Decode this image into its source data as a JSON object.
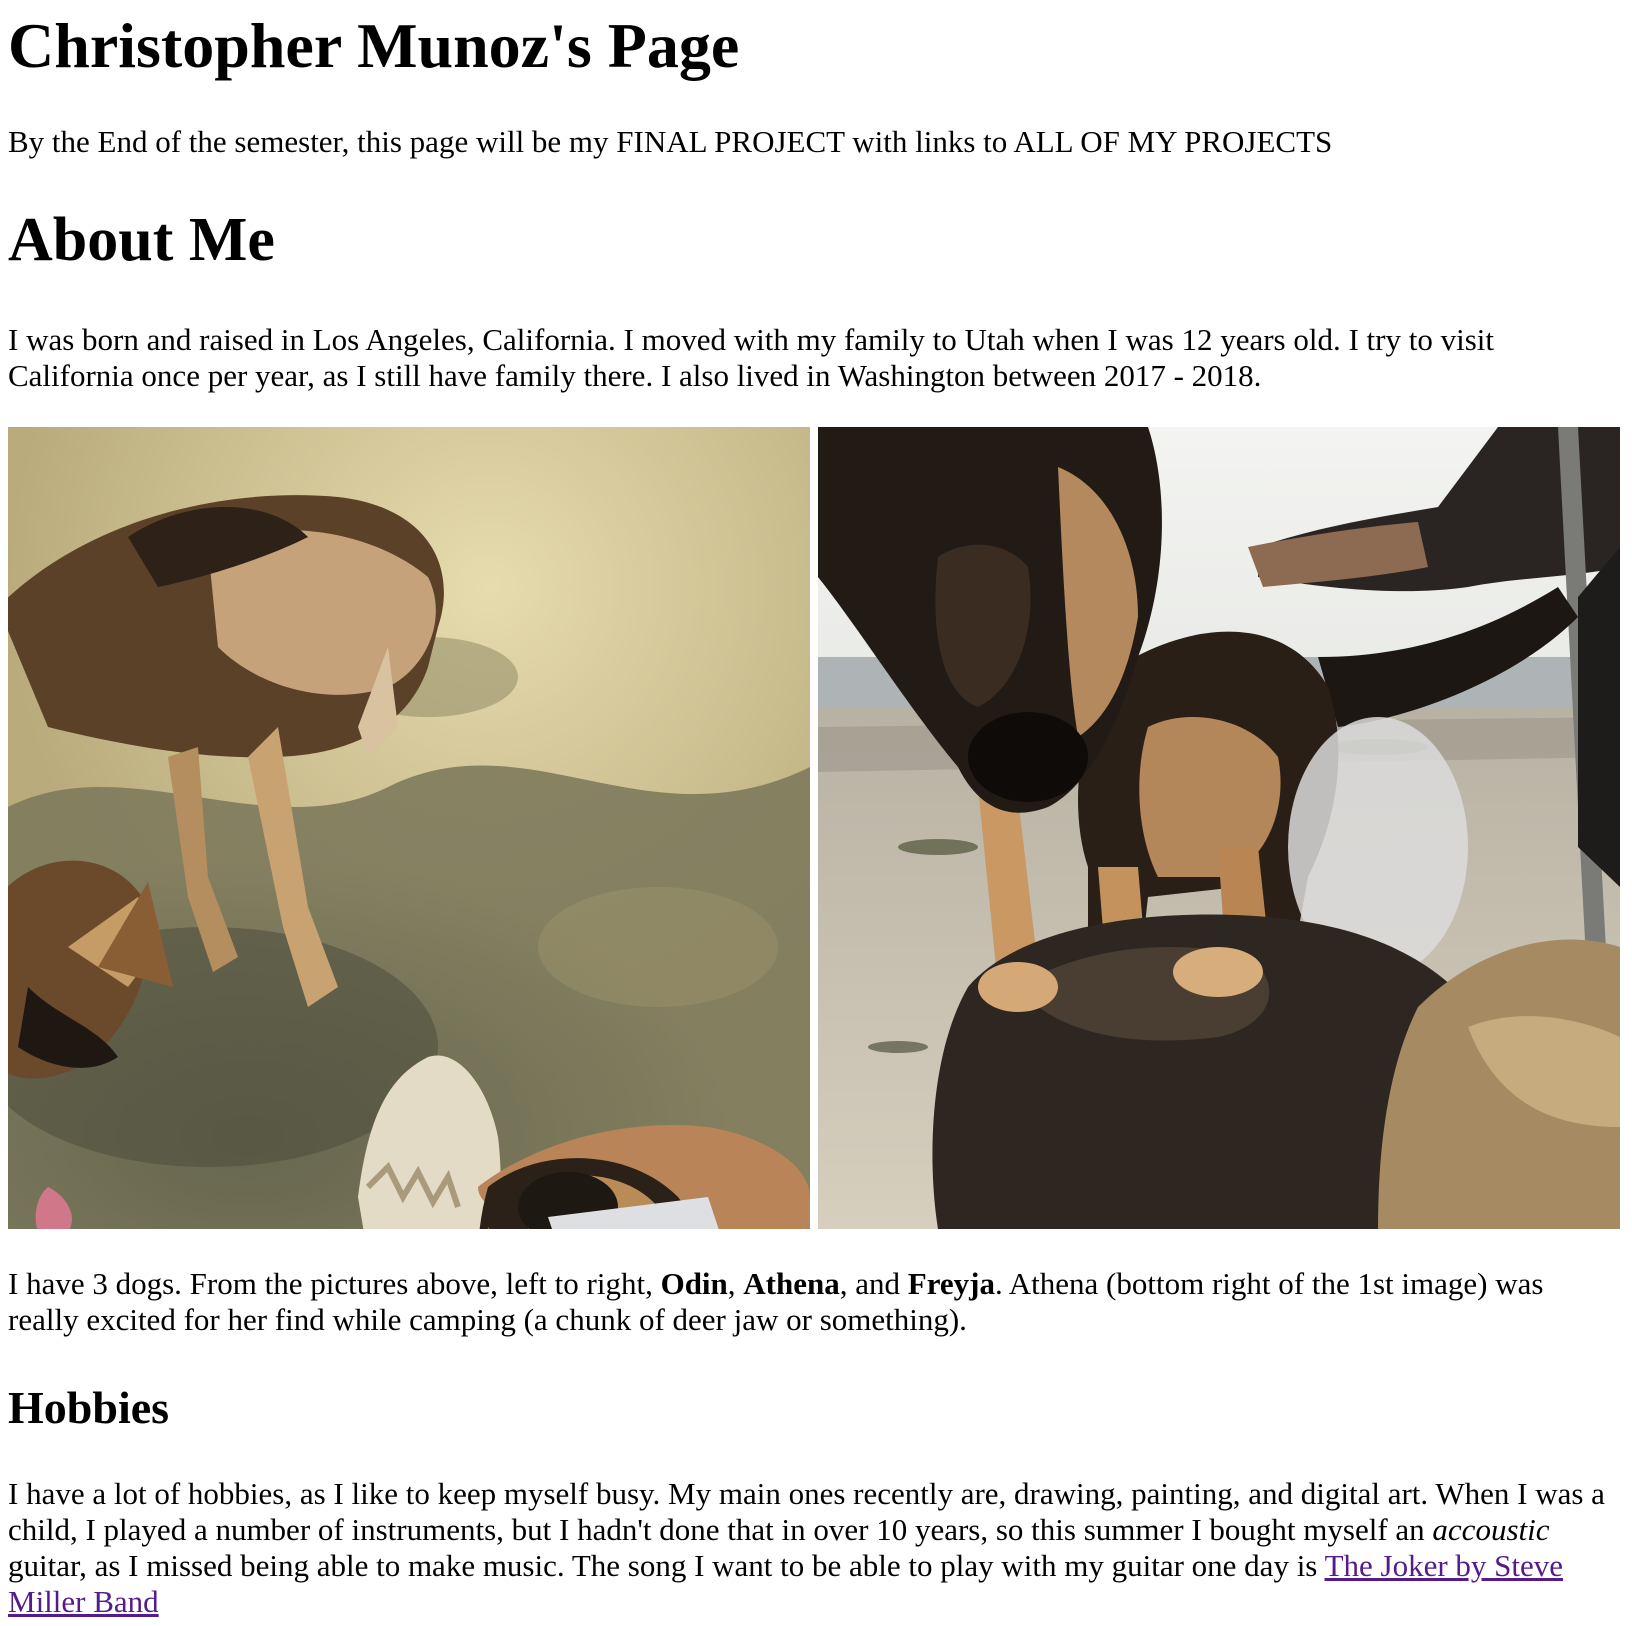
{
  "page": {
    "title": "Christopher Munoz's Page",
    "intro": "By the End of the semester, this page will be my FINAL PROJECT with links to ALL OF MY PROJECTS"
  },
  "about": {
    "heading": "About Me",
    "paragraph": "I was born and raised in Los Angeles, California. I moved with my family to Utah when I was 12 years old. I try to visit California once per year, as I still have family there. I also lived in Washington between 2017 - 2018."
  },
  "photos": [
    {
      "alt": "Odin and Athena with a chunk of deer jaw"
    },
    {
      "alt": "Freyja on the beach"
    }
  ],
  "dogs": {
    "text_1": "I have 3 dogs. From the pictures above, left to right, ",
    "name_1": "Odin",
    "sep_1": ", ",
    "name_2": "Athena",
    "sep_2": ", and ",
    "name_3": "Freyja",
    "text_2": ". Athena (bottom right of the 1st image) was really excited for her find while camping (a chunk of deer jaw or something)."
  },
  "hobbies": {
    "heading": "Hobbies",
    "text_1": "I have a lot of hobbies, as I like to keep myself busy. My main ones recently are, drawing, painting, and digital art. When I was a child, I played a number of instruments, but I hadn't done that in over 10 years, so this summer I bought myself an ",
    "emphasis": "accoustic",
    "text_2": " guitar, as I missed being able to make music. The song I want to be able to play with my guitar one day is ",
    "link_text": "The Joker by Steve Miller Band"
  }
}
